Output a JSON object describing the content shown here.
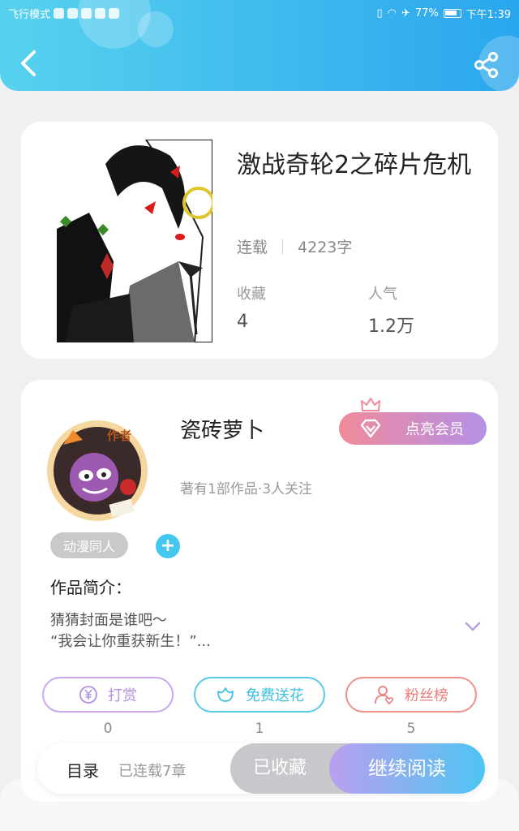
{
  "status_bar": {
    "airplane_mode": "飞行模式",
    "battery_percent": "77%",
    "time": "下午1:39",
    "icons": [
      "vibrate-icon",
      "wifi-icon",
      "airplane-icon",
      "battery-icon"
    ]
  },
  "header": {
    "back_icon": "chevron-left-icon",
    "share_icon": "share-icon",
    "colors": {
      "from": "#57d2ee",
      "to": "#2aa6ee"
    }
  },
  "book": {
    "title": "激战奇轮2之碎片危机",
    "status": "连载",
    "word_count": "4223字",
    "favorites_label": "收藏",
    "favorites_value": "4",
    "popularity_label": "人气",
    "popularity_value": "1.2万"
  },
  "author": {
    "name": "瓷砖萝卜",
    "badge": "作者",
    "meta": "著有1部作品·3人关注",
    "vip_button": "点亮会员",
    "tag": "动漫同人",
    "add_tag": "+"
  },
  "intro": {
    "title": "作品简介：",
    "line1": "猜猜封面是谁吧～",
    "line2": "“我会让你重获新生！”..."
  },
  "actions": [
    {
      "label": "打赏",
      "count": "0",
      "icon": "yen-icon",
      "color": "#c9a6ee"
    },
    {
      "label": "免费送花",
      "count": "1",
      "icon": "flower-icon",
      "color": "#55ccea"
    },
    {
      "label": "粉丝榜",
      "count": "5",
      "icon": "fans-icon",
      "color": "#f0908e"
    }
  ],
  "bottom_bar": {
    "catalog": "目录",
    "chapters": "已连载7章",
    "collected": "已收藏",
    "read": "继续阅读"
  }
}
